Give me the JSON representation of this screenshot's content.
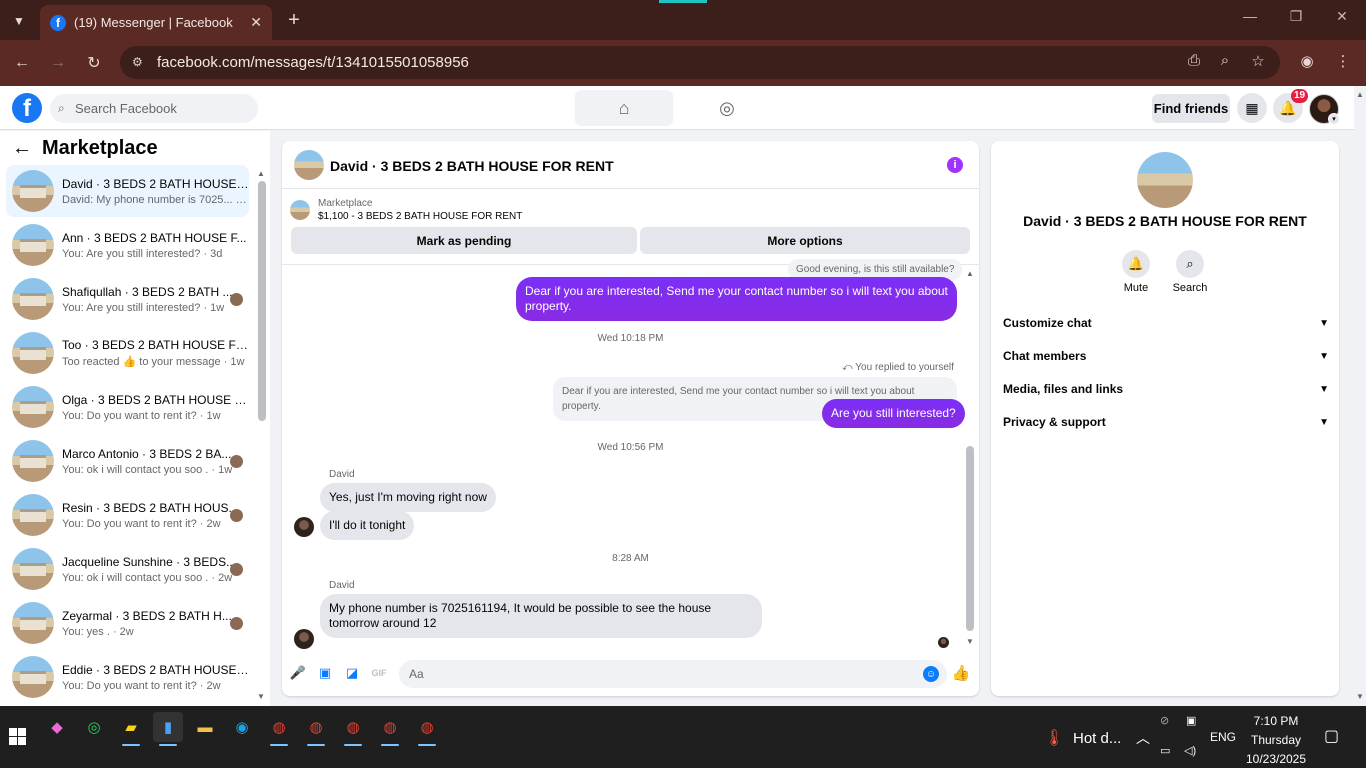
{
  "browser": {
    "tab_title": "(19) Messenger | Facebook",
    "url": "facebook.com/messages/t/1341015501058956"
  },
  "fb": {
    "search_placeholder": "Search Facebook",
    "find_friends": "Find friends",
    "notif_count": "19",
    "brand_color": "#1877f2"
  },
  "sidebar": {
    "title": "Marketplace",
    "conversations": [
      {
        "name": "David · 3 BEDS 2 BATH HOUSE ...",
        "preview": "David: My phone number is 7025... · 10h",
        "active": true
      },
      {
        "name": "Ann · 3 BEDS 2 BATH HOUSE F...",
        "preview": "You: Are you still interested? · 3d"
      },
      {
        "name": "Shafiqullah · 3 BEDS 2 BATH ...",
        "preview": "You: Are you still interested? · 1w"
      },
      {
        "name": "Too · 3 BEDS 2 BATH HOUSE FO...",
        "preview": "Too reacted 👍 to your message · 1w"
      },
      {
        "name": "Olga · 3 BEDS 2 BATH HOUSE F...",
        "preview": "You: Do you want to rent it? · 1w"
      },
      {
        "name": "Marco Antonio · 3 BEDS 2 BA...",
        "preview": "You: ok i will contact you soo . · 1w"
      },
      {
        "name": "Resin · 3 BEDS 2 BATH HOUS...",
        "preview": "You: Do you want to rent it? · 2w"
      },
      {
        "name": "Jacqueline Sunshine · 3 BEDS...",
        "preview": "You: ok i will contact you soo . · 2w"
      },
      {
        "name": "Zeyarmal · 3 BEDS 2 BATH H...",
        "preview": "You: yes . · 2w"
      },
      {
        "name": "Eddie · 3 BEDS 2 BATH HOUSE ...",
        "preview": "You: Do you want to rent it? · 2w"
      }
    ]
  },
  "chat": {
    "title": "David · 3 BEDS 2 BATH HOUSE FOR RENT",
    "marketplace_label": "Marketplace",
    "listing": "$1,100 - 3 BEDS 2 BATH HOUSE FOR RENT",
    "mark_pending": "Mark as pending",
    "more_options": "More options",
    "top_quoted": "Good evening, is this still available?",
    "msg1": "Dear if you are interested, Send me your contact number so i will text you about property.",
    "ts1": "Wed 10:18 PM",
    "replied_note": "You replied to yourself",
    "quoted2": "Dear if you are interested, Send me your contact number so i will text you about property.",
    "msg2": "Are you still interested?",
    "ts2": "Wed 10:56 PM",
    "sender1": "David",
    "in1": "Yes, just I'm moving right now",
    "in2": "I'll do it tonight",
    "ts3": "8:28 AM",
    "sender2": "David",
    "in3": "My phone number is 7025161194, It would be possible to see the house tomorrow around 12",
    "input_placeholder": "Aa",
    "accent_color": "#8a2be2"
  },
  "rpanel": {
    "name": "David · 3 BEDS 2 BATH HOUSE FOR RENT",
    "mute": "Mute",
    "search": "Search",
    "rows": [
      "Customize chat",
      "Chat members",
      "Media, files and links",
      "Privacy & support"
    ]
  },
  "taskbar": {
    "weather": "Hot d...",
    "lang": "ENG",
    "time": "7:10 PM",
    "day": "Thursday",
    "date": "10/23/2025"
  }
}
